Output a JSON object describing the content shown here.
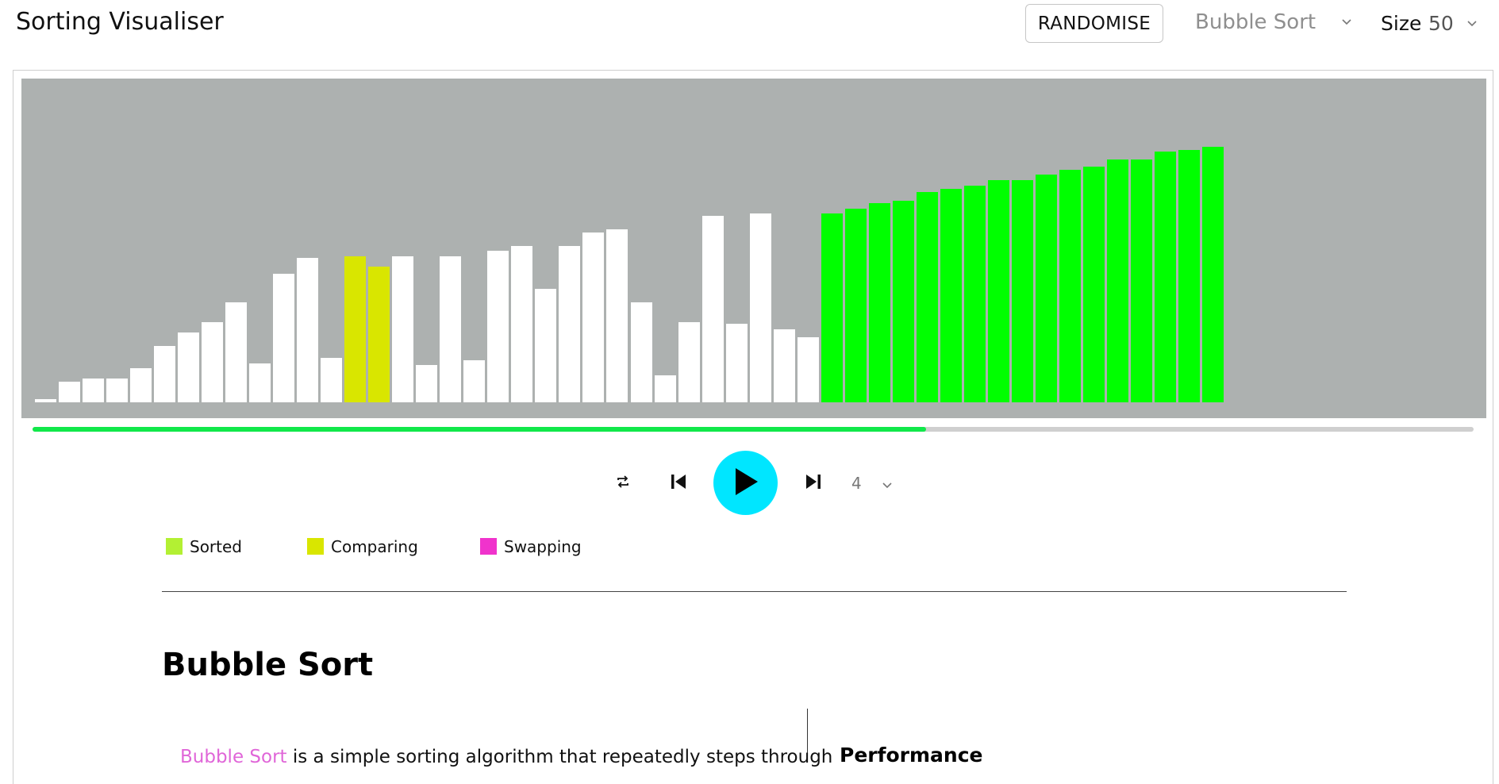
{
  "app": {
    "title": "Sorting Visualiser"
  },
  "toolbar": {
    "randomise_label": "RANDOMISE",
    "algorithm": {
      "selected": "Bubble Sort",
      "icon": "chevron-down-icon"
    },
    "size": {
      "label": "Size",
      "value": "50",
      "icon": "chevron-down-icon"
    }
  },
  "visualizer": {
    "bar_values": [
      3,
      20,
      23,
      23,
      33,
      55,
      68,
      78,
      97,
      38,
      125,
      140,
      43,
      142,
      132,
      142,
      36,
      142,
      41,
      147,
      152,
      110,
      152,
      165,
      168,
      97,
      26,
      78,
      181,
      76,
      183,
      71,
      63,
      183,
      188,
      193,
      196,
      204,
      207,
      210,
      216,
      216,
      221,
      226,
      229,
      236,
      236,
      243,
      245,
      248
    ],
    "max_value": 248,
    "comparing_indices": [
      13,
      14
    ],
    "sorted_from_index": 33,
    "colors": {
      "default": "#ffffff",
      "comparing": "#d9e600",
      "sorted": "#00ff00",
      "background": "#adb1b0"
    },
    "progress_percent": 62
  },
  "controls": {
    "repeat_icon": "repeat-icon",
    "previous_icon": "skip-previous-icon",
    "play_icon": "play-icon",
    "next_icon": "skip-next-icon",
    "speed": {
      "value": "4",
      "icon": "chevron-down-icon"
    }
  },
  "legend": [
    {
      "label": "Sorted",
      "color": "#b3f033"
    },
    {
      "label": "Comparing",
      "color": "#d9e600"
    },
    {
      "label": "Swapping",
      "color": "#f033cc"
    }
  ],
  "info": {
    "title": "Bubble Sort",
    "description": {
      "link": "Bubble Sort",
      "text": " is a simple sorting algorithm that repeatedly steps through"
    },
    "performance_title": "Performance"
  }
}
